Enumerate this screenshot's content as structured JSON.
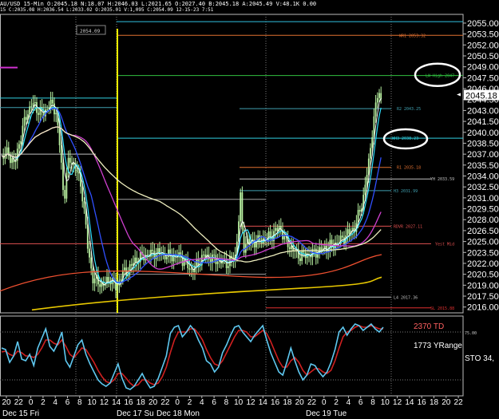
{
  "header": {
    "line1": "AU/USD 15-Min O:2045.18 N:18.07 H:2046.03 L:2021.65 O:2027.40 B:2045.18 A:2045.49 V:48.1K 0.00",
    "line2": "15 C:2035.08 H:2036.54 L:2033.02 O:2035.01 V:1,095 C:2054.09 12-15-23 7:51"
  },
  "colors": {
    "background": "#000000",
    "candle": "#b8f0a0",
    "price_ma": "#2fe0ff",
    "stoch_k": "#5fc8f0",
    "stoch_d": "#d02020"
  },
  "chart_data": [
    {
      "type": "line",
      "panel": "price",
      "ylim": [
        2015.2,
        2056.2
      ],
      "price_ticks": [
        "2055.00",
        "2053.50",
        "2052.00",
        "2050.50",
        "2049.00",
        "2047.50",
        "2046.00",
        "2044.50",
        "2043.00",
        "2041.50",
        "2040.00",
        "2038.50",
        "2037.00",
        "2035.50",
        "2034.00",
        "2032.50",
        "2031.00",
        "2029.50",
        "2028.00",
        "2026.50",
        "2025.00",
        "2023.50",
        "2022.00",
        "2020.50",
        "2019.00",
        "2017.50",
        "2016.00"
      ],
      "current_price": "2045.18",
      "levels": [
        {
          "label": "WR1 2053.32",
          "value": 2053.32,
          "color": "#e07030"
        },
        {
          "label": "LW High 2047",
          "value": 2047.8,
          "color": "#30c040"
        },
        {
          "label": "R2 2043.25",
          "value": 2043.25,
          "color": "#40a0b0"
        },
        {
          "label": "WH3 2038.23",
          "value": 2039.2,
          "color": "#30d0e0"
        },
        {
          "label": "R1 2035.18",
          "value": 2035.18,
          "color": "#e07030"
        },
        {
          "label": "YH 2033.59",
          "value": 2033.59,
          "color": "#c0c0c0"
        },
        {
          "label": "H3 2031.99",
          "value": 2031.99,
          "color": "#40a0b0"
        },
        {
          "label": "RDVR 2027.11",
          "value": 2027.11,
          "color": "#e05050"
        },
        {
          "label": "Yest Mid",
          "value": 2024.7,
          "color": "#e05050"
        },
        {
          "label": "L4 2017.36",
          "value": 2017.36,
          "color": "#c0c0c0"
        },
        {
          "label": "SL 2015.88",
          "value": 2015.88,
          "color": "#e03030"
        }
      ],
      "tag": "2054.09",
      "annotations": [
        "LW High 2047",
        "WH3 2038.23"
      ]
    },
    {
      "type": "line",
      "panel": "oscillator",
      "ylim": [
        0,
        100
      ],
      "labels": [
        "2370 TD",
        "1773 YRange",
        "STO 34,"
      ],
      "series": [
        {
          "values": [
            60,
            58,
            42,
            50,
            68,
            46,
            44,
            52,
            38,
            60,
            72,
            84,
            62,
            56,
            66,
            80,
            44,
            36,
            50,
            64,
            70,
            52,
            40,
            30,
            20,
            15,
            12,
            16,
            28,
            40,
            22,
            10,
            8,
            12,
            20,
            28,
            18,
            10,
            12,
            22,
            36,
            50,
            78,
            86,
            88,
            74,
            80,
            88,
            82,
            70,
            60,
            44,
            40,
            30,
            36,
            54,
            64,
            76,
            86,
            88,
            80,
            74,
            68,
            76,
            82,
            88,
            70,
            54,
            42,
            30,
            26,
            42,
            60,
            44,
            30,
            20,
            26,
            40,
            38,
            30,
            24,
            30,
            42,
            58,
            80,
            86,
            76,
            84,
            90,
            88,
            82,
            86,
            90,
            84,
            80,
            86
          ]
        },
        {
          "values": [
            55,
            56,
            52,
            50,
            56,
            54,
            50,
            50,
            48,
            52,
            60,
            70,
            70,
            66,
            64,
            70,
            62,
            52,
            48,
            54,
            60,
            58,
            50,
            42,
            32,
            24,
            18,
            16,
            20,
            28,
            28,
            22,
            16,
            12,
            14,
            20,
            20,
            16,
            14,
            16,
            24,
            36,
            54,
            70,
            80,
            80,
            80,
            84,
            84,
            78,
            70,
            58,
            48,
            40,
            38,
            44,
            54,
            64,
            74,
            82,
            82,
            80,
            74,
            74,
            78,
            82,
            78,
            68,
            56,
            44,
            36,
            36,
            44,
            48,
            42,
            32,
            26,
            30,
            34,
            34,
            30,
            28,
            32,
            44,
            60,
            74,
            80,
            82,
            86,
            88,
            86,
            86,
            88,
            86,
            84,
            84
          ]
        }
      ]
    }
  ],
  "x_axis": {
    "ticks": [
      "20",
      "22",
      "0",
      "2",
      "4",
      "6",
      "8",
      "10",
      "12",
      "14",
      "16",
      "18",
      "20",
      "22",
      "0",
      "2",
      "4",
      "6",
      "8",
      "10",
      "12",
      "14",
      "16",
      "18",
      "20",
      "22",
      "0",
      "2",
      "4",
      "6",
      "8",
      "10",
      "12",
      "14",
      "16",
      "18",
      "20",
      "22"
    ],
    "day_labels": [
      "Dec 15 Fri",
      "Dec 17 Su",
      "Dec 18 Mon",
      "Dec 19 Tue"
    ]
  }
}
